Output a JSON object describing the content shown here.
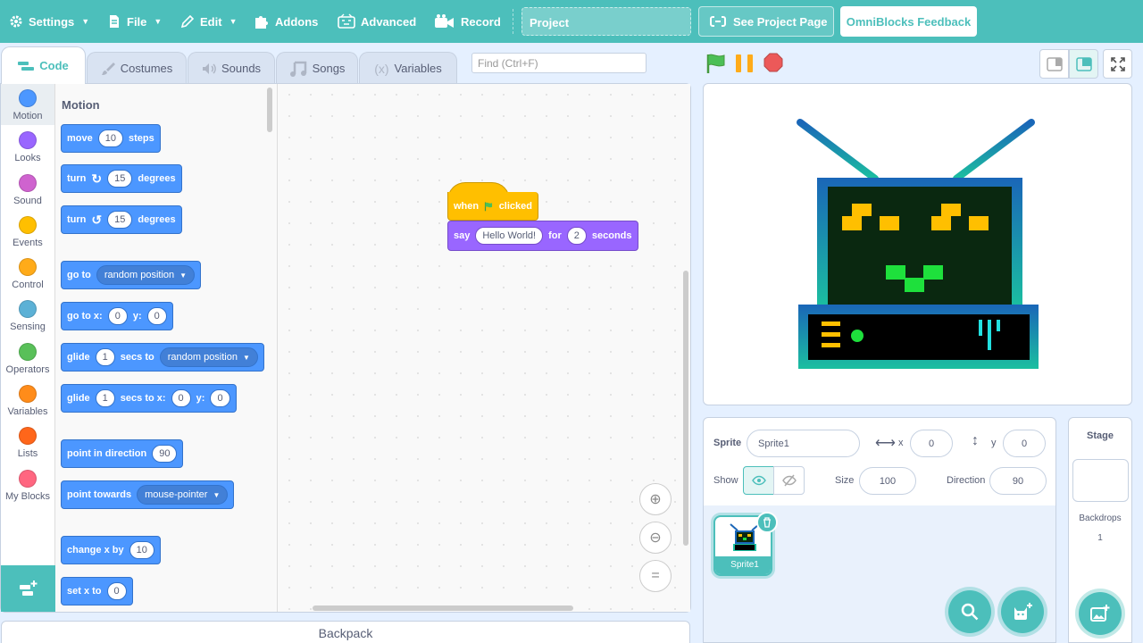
{
  "menubar": {
    "settings": "Settings",
    "file": "File",
    "edit": "Edit",
    "addons": "Addons",
    "advanced": "Advanced",
    "record": "Record",
    "project_title": "Project",
    "see_project_page": "See Project Page",
    "feedback": "OmniBlocks Feedback"
  },
  "tabs": [
    "Code",
    "Costumes",
    "Sounds",
    "Songs",
    "Variables"
  ],
  "search": {
    "placeholder": "Find (Ctrl+F)"
  },
  "categories": [
    {
      "label": "Motion",
      "color": "#4c97ff"
    },
    {
      "label": "Looks",
      "color": "#9966ff"
    },
    {
      "label": "Sound",
      "color": "#cf63cf"
    },
    {
      "label": "Events",
      "color": "#ffbf00"
    },
    {
      "label": "Control",
      "color": "#ffab19"
    },
    {
      "label": "Sensing",
      "color": "#5cb1d6"
    },
    {
      "label": "Operators",
      "color": "#59c059"
    },
    {
      "label": "Variables",
      "color": "#ff8c1a"
    },
    {
      "label": "Lists",
      "color": "#ff661a"
    },
    {
      "label": "My Blocks",
      "color": "#ff6680"
    }
  ],
  "palette": {
    "heading": "Motion",
    "blocks": {
      "move": {
        "t1": "move",
        "v1": "10",
        "t2": "steps"
      },
      "turn_cw": {
        "t1": "turn",
        "v1": "15",
        "t2": "degrees"
      },
      "turn_ccw": {
        "t1": "turn",
        "v1": "15",
        "t2": "degrees"
      },
      "goto": {
        "t1": "go to",
        "d1": "random position"
      },
      "goto_xy": {
        "t1": "go to x:",
        "v1": "0",
        "t2": "y:",
        "v2": "0"
      },
      "glide": {
        "t1": "glide",
        "v1": "1",
        "t2": "secs to",
        "d1": "random position"
      },
      "glide_xy": {
        "t1": "glide",
        "v1": "1",
        "t2": "secs to x:",
        "v2": "0",
        "t3": "y:",
        "v3": "0"
      },
      "point_dir": {
        "t1": "point in direction",
        "v1": "90"
      },
      "point_towards": {
        "t1": "point towards",
        "d1": "mouse-pointer"
      },
      "change_x": {
        "t1": "change x by",
        "v1": "10"
      },
      "set_x": {
        "t1": "set x to",
        "v1": "0"
      }
    }
  },
  "script": {
    "hat": {
      "t1": "when",
      "t2": "clicked"
    },
    "say": {
      "t1": "say",
      "v1": "Hello World!",
      "t2": "for",
      "v2": "2",
      "t3": "seconds"
    }
  },
  "backpack": "Backpack",
  "sprite_info": {
    "sprite_label": "Sprite",
    "sprite_name": "Sprite1",
    "x_label": "x",
    "x_value": "0",
    "y_label": "y",
    "y_value": "0",
    "show_label": "Show",
    "size_label": "Size",
    "size_value": "100",
    "direction_label": "Direction",
    "direction_value": "90"
  },
  "sprites": [
    {
      "name": "Sprite1"
    }
  ],
  "stage_panel": {
    "title": "Stage",
    "backdrops_label": "Backdrops",
    "backdrops_count": "1"
  },
  "colors": {
    "accent": "#4cbfbb",
    "motion": "#4c97ff",
    "events": "#ffbf00",
    "looks": "#9966ff"
  }
}
